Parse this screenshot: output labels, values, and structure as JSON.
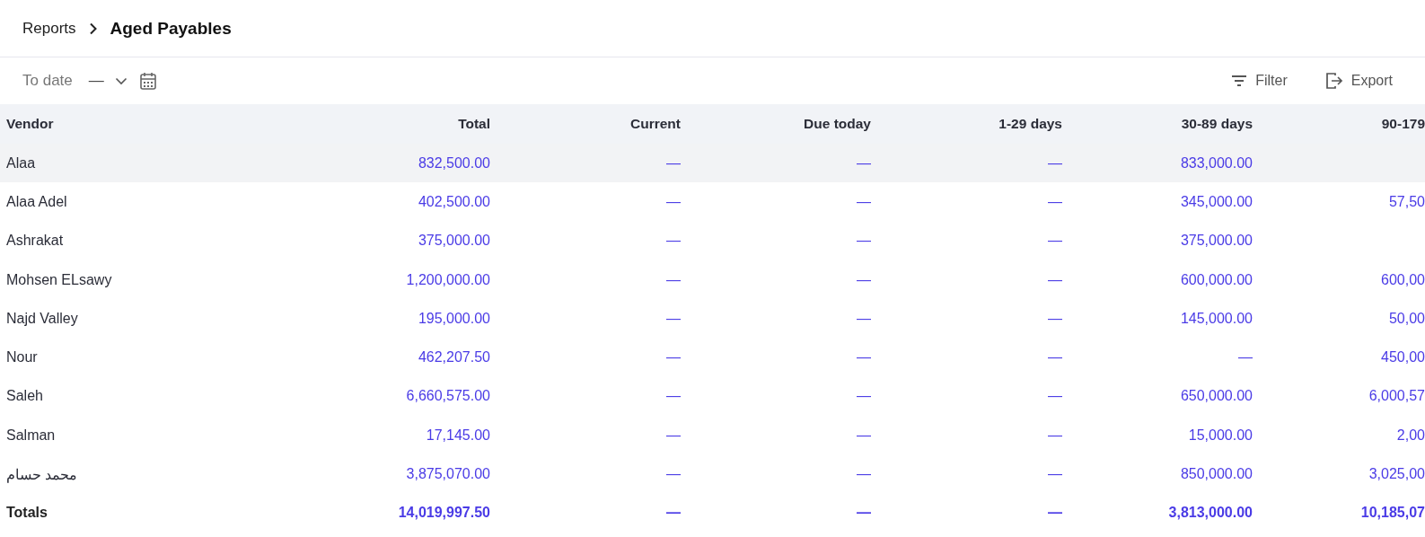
{
  "breadcrumb": {
    "parent": "Reports",
    "current": "Aged Payables"
  },
  "toolbar": {
    "date_label": "To date",
    "date_value": "—",
    "filter": "Filter",
    "export": "Export"
  },
  "table": {
    "columns": [
      "Vendor",
      "Total",
      "Current",
      "Due today",
      "1-29 days",
      "30-89 days",
      "90-179"
    ],
    "rows": [
      {
        "cells": [
          "Alaa",
          "832,500.00",
          "—",
          "—",
          "—",
          "833,000.00",
          null
        ],
        "selected": true
      },
      {
        "cells": [
          "Alaa Adel",
          "402,500.00",
          "—",
          "—",
          "—",
          "345,000.00",
          "57,50"
        ],
        "selected": false
      },
      {
        "cells": [
          "Ashrakat",
          "375,000.00",
          "—",
          "—",
          "—",
          "375,000.00",
          null
        ],
        "selected": false
      },
      {
        "cells": [
          "Mohsen ELsawy",
          "1,200,000.00",
          "—",
          "—",
          "—",
          "600,000.00",
          "600,00"
        ],
        "selected": false
      },
      {
        "cells": [
          "Najd Valley",
          "195,000.00",
          "—",
          "—",
          "—",
          "145,000.00",
          "50,00"
        ],
        "selected": false
      },
      {
        "cells": [
          "Nour",
          "462,207.50",
          "—",
          "—",
          "—",
          "—",
          "450,00"
        ],
        "selected": false
      },
      {
        "cells": [
          "Saleh",
          "6,660,575.00",
          "—",
          "—",
          "—",
          "650,000.00",
          "6,000,57"
        ],
        "selected": false
      },
      {
        "cells": [
          "Salman",
          "17,145.00",
          "—",
          "—",
          "—",
          "15,000.00",
          "2,00"
        ],
        "selected": false
      },
      {
        "cells": [
          "محمد حسام",
          "3,875,070.00",
          "—",
          "—",
          "—",
          "850,000.00",
          "3,025,00"
        ],
        "selected": false
      }
    ],
    "totals": {
      "cells": [
        "Totals",
        "14,019,997.50",
        "—",
        "—",
        "—",
        "3,813,000.00",
        "10,185,07"
      ]
    }
  }
}
